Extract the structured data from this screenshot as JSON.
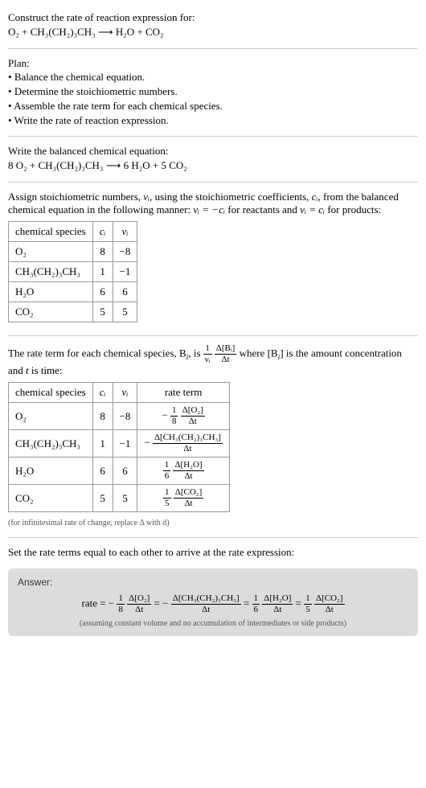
{
  "header": {
    "prompt": "Construct the rate of reaction expression for:",
    "equation": "O₂ + CH₃(CH₂)₃CH₃  ⟶  H₂O + CO₂"
  },
  "plan": {
    "title": "Plan:",
    "items": [
      "Balance the chemical equation.",
      "Determine the stoichiometric numbers.",
      "Assemble the rate term for each chemical species.",
      "Write the rate of reaction expression."
    ]
  },
  "balanced": {
    "title": "Write the balanced chemical equation:",
    "equation": "8 O₂ + CH₃(CH₂)₃CH₃  ⟶  6 H₂O + 5 CO₂"
  },
  "stoich": {
    "intro_a": "Assign stoichiometric numbers, ",
    "intro_b": ", using the stoichiometric coefficients, ",
    "intro_c": ", from the balanced chemical equation in the following manner: ",
    "intro_d": " for reactants and ",
    "intro_e": " for products:",
    "nu_eq_neg_c": "νᵢ = −cᵢ",
    "nu_eq_c": "νᵢ = cᵢ",
    "nu_i": "νᵢ",
    "c_i": "cᵢ",
    "headers": {
      "species": "chemical species",
      "ci": "cᵢ",
      "nui": "νᵢ"
    },
    "rows": [
      {
        "species": "O₂",
        "ci": "8",
        "nui": "−8"
      },
      {
        "species": "CH₃(CH₂)₃CH₃",
        "ci": "1",
        "nui": "−1"
      },
      {
        "species": "H₂O",
        "ci": "6",
        "nui": "6"
      },
      {
        "species": "CO₂",
        "ci": "5",
        "nui": "5"
      }
    ]
  },
  "rate_term": {
    "intro_a": "The rate term for each chemical species, B",
    "intro_b": ", is ",
    "intro_c": " where [B",
    "intro_d": "] is the amount concentration and ",
    "intro_e": " is time:",
    "t_label": "t",
    "i_label": "i",
    "headers": {
      "species": "chemical species",
      "ci": "cᵢ",
      "nui": "νᵢ",
      "rate": "rate term"
    },
    "rows": [
      {
        "species": "O₂",
        "ci": "8",
        "nui": "−8",
        "neg": "−",
        "coef_num": "1",
        "coef_den": "8",
        "conc": "Δ[O₂]",
        "dt": "Δt"
      },
      {
        "species": "CH₃(CH₂)₃CH₃",
        "ci": "1",
        "nui": "−1",
        "neg": "−",
        "coef_num": "",
        "coef_den": "",
        "conc": "Δ[CH₃(CH₂)₃CH₃]",
        "dt": "Δt"
      },
      {
        "species": "H₂O",
        "ci": "6",
        "nui": "6",
        "neg": "",
        "coef_num": "1",
        "coef_den": "6",
        "conc": "Δ[H₂O]",
        "dt": "Δt"
      },
      {
        "species": "CO₂",
        "ci": "5",
        "nui": "5",
        "neg": "",
        "coef_num": "1",
        "coef_den": "5",
        "conc": "Δ[CO₂]",
        "dt": "Δt"
      }
    ],
    "note": "(for infinitesimal rate of change, replace Δ with d)"
  },
  "final": {
    "intro": "Set the rate terms equal to each other to arrive at the rate expression:"
  },
  "answer": {
    "label": "Answer:",
    "rate_label": "rate = ",
    "neg": "−",
    "eq": " = ",
    "terms": [
      {
        "coef_num": "1",
        "coef_den": "8",
        "conc": "Δ[O₂]",
        "dt": "Δt"
      },
      {
        "coef_num": "",
        "coef_den": "",
        "conc": "Δ[CH₃(CH₂)₃CH₃]",
        "dt": "Δt"
      },
      {
        "coef_num": "1",
        "coef_den": "6",
        "conc": "Δ[H₂O]",
        "dt": "Δt"
      },
      {
        "coef_num": "1",
        "coef_den": "5",
        "conc": "Δ[CO₂]",
        "dt": "Δt"
      }
    ],
    "assumption": "(assuming constant volume and no accumulation of intermediates or side products)"
  },
  "general_frac": {
    "one": "1",
    "nu_i": "νᵢ",
    "dBi": "Δ[Bᵢ]",
    "dt": "Δt"
  }
}
